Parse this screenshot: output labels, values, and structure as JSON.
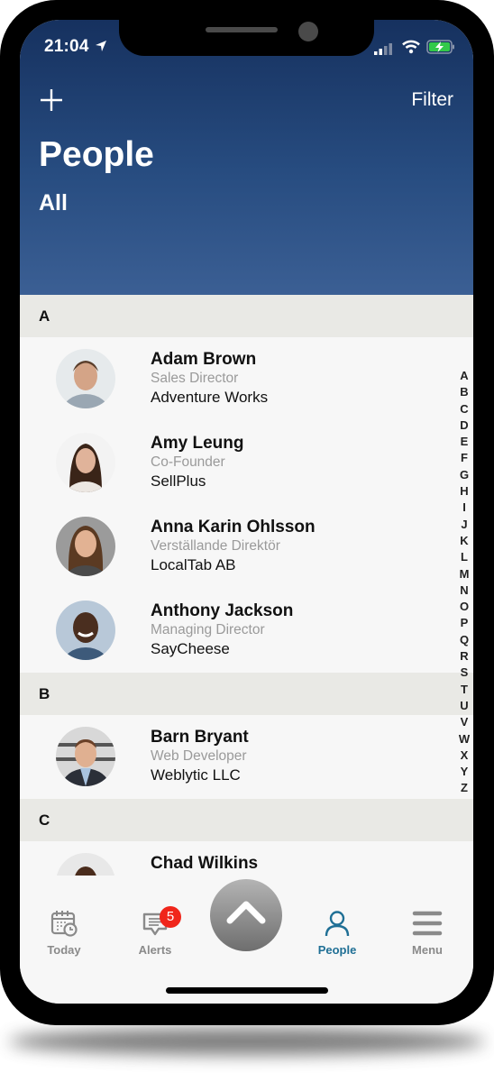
{
  "status_bar": {
    "time": "21:04",
    "icons": [
      "location-arrow-icon",
      "cellular-signal-icon",
      "wifi-icon",
      "battery-charging-icon"
    ],
    "battery_color": "#33c94a"
  },
  "header": {
    "add_icon": "plus-icon",
    "filter_label": "Filter",
    "title": "People",
    "subtitle": "All",
    "gradient_top": "#16315f",
    "gradient_bottom": "#3b5f94"
  },
  "sections": [
    {
      "letter": "A",
      "people": [
        {
          "name": "Adam Brown",
          "role": "Sales Director",
          "company": "Adventure Works"
        },
        {
          "name": "Amy Leung",
          "role": "Co-Founder",
          "company": "SellPlus"
        },
        {
          "name": "Anna Karin Ohlsson",
          "role": "Verställande Direktör",
          "company": "LocalTab AB"
        },
        {
          "name": "Anthony Jackson",
          "role": "Managing Director",
          "company": "SayCheese"
        }
      ]
    },
    {
      "letter": "B",
      "people": [
        {
          "name": "Barn Bryant",
          "role": "Web Developer",
          "company": "Weblytic LLC"
        }
      ]
    },
    {
      "letter": "C",
      "people": [
        {
          "name": "Chad Wilkins",
          "role": "",
          "company": ""
        }
      ]
    }
  ],
  "alphabet_index": [
    "A",
    "B",
    "C",
    "D",
    "E",
    "F",
    "G",
    "H",
    "I",
    "J",
    "K",
    "L",
    "M",
    "N",
    "O",
    "P",
    "Q",
    "R",
    "S",
    "T",
    "U",
    "V",
    "W",
    "X",
    "Y",
    "Z"
  ],
  "tabbar": {
    "tabs": [
      {
        "label": "Today",
        "icon": "calendar-clock-icon",
        "active": false
      },
      {
        "label": "Alerts",
        "icon": "chat-bubble-icon",
        "active": false,
        "badge": "5"
      },
      {
        "label": "People",
        "icon": "person-icon",
        "active": true
      },
      {
        "label": "Menu",
        "icon": "hamburger-menu-icon",
        "active": false
      }
    ],
    "fab_icon": "chevron-up-icon",
    "active_color": "#1f6f95",
    "inactive_color": "#8a8a8a",
    "badge_color": "#f0261b"
  }
}
